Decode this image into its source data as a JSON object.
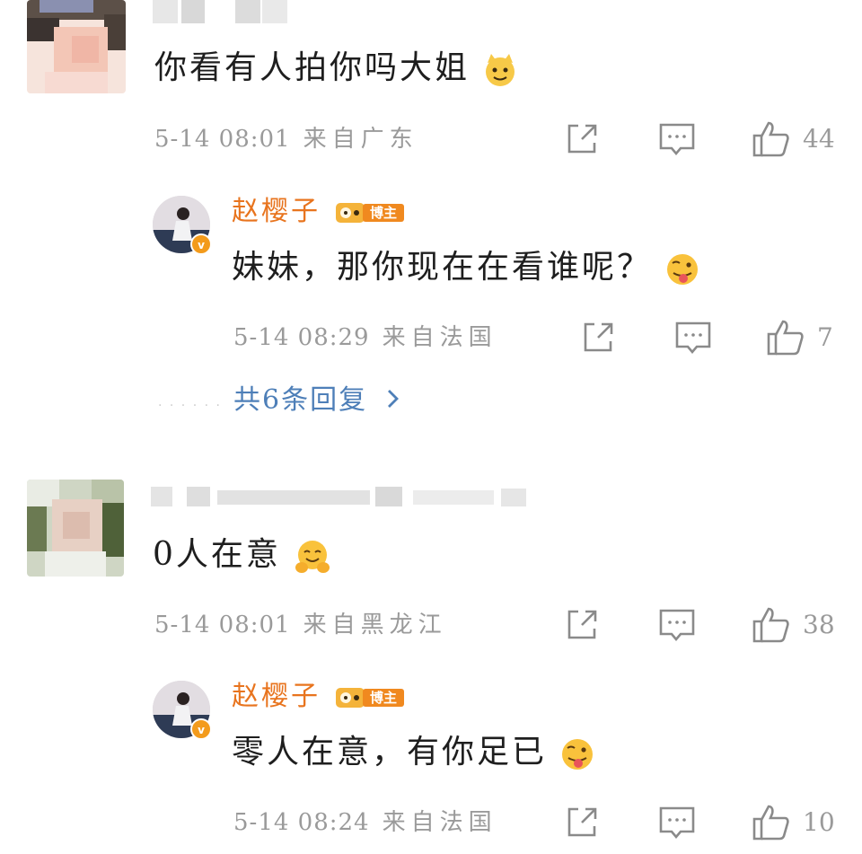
{
  "comments": [
    {
      "text": "你看有人拍你吗大姐",
      "emoji": "cat-face",
      "time": "5-14 08:01",
      "location": "来自广东",
      "likes": "44",
      "reply": {
        "author": "赵樱子",
        "badge": "博主",
        "text": "妹妹，那你现在在看谁呢？",
        "emoji": "tongue-face",
        "time": "5-14 08:29",
        "location": "来自法国",
        "likes": "7",
        "more": "共6条回复"
      }
    },
    {
      "text": "0人在意",
      "emoji": "hugging-face",
      "time": "5-14 08:01",
      "location": "来自黑龙江",
      "likes": "38",
      "reply": {
        "author": "赵樱子",
        "badge": "博主",
        "text": "零人在意，有你足已",
        "emoji": "tongue-face",
        "time": "5-14 08:24",
        "location": "来自法国",
        "likes": "10"
      }
    }
  ],
  "icons": {
    "share": "share-icon",
    "comment": "comment-icon",
    "like": "thumbs-up-icon"
  },
  "colors": {
    "author_orange": "#e8741e",
    "link_blue": "#4e7fb8",
    "meta_gray": "#9a9a9a"
  }
}
